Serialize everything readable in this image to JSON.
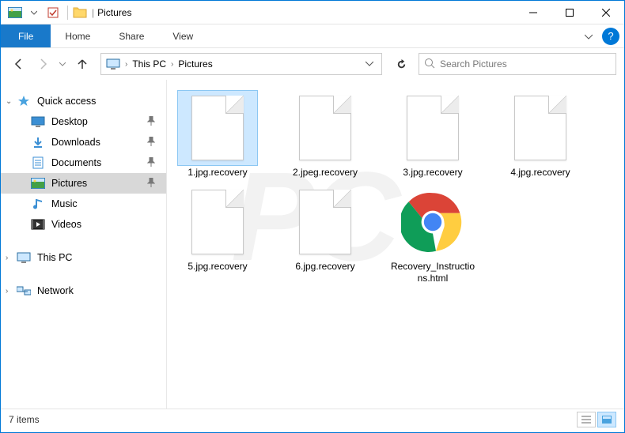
{
  "window": {
    "title": "Pictures"
  },
  "ribbon": {
    "file": "File",
    "tabs": [
      "Home",
      "Share",
      "View"
    ]
  },
  "breadcrumb": {
    "root_chev": "›",
    "items": [
      "This PC",
      "Pictures"
    ]
  },
  "search": {
    "placeholder": "Search Pictures"
  },
  "nav_pane": {
    "quick_access": {
      "label": "Quick access",
      "items": [
        {
          "label": "Desktop",
          "pinned": true
        },
        {
          "label": "Downloads",
          "pinned": true
        },
        {
          "label": "Documents",
          "pinned": true
        },
        {
          "label": "Pictures",
          "pinned": true,
          "selected": true
        },
        {
          "label": "Music",
          "pinned": false
        },
        {
          "label": "Videos",
          "pinned": false
        }
      ]
    },
    "this_pc": {
      "label": "This PC"
    },
    "network": {
      "label": "Network"
    }
  },
  "files": [
    {
      "name": "1.jpg.recovery",
      "icon": "blank",
      "selected": true
    },
    {
      "name": "2.jpeg.recovery",
      "icon": "blank"
    },
    {
      "name": "3.jpg.recovery",
      "icon": "blank"
    },
    {
      "name": "4.jpg.recovery",
      "icon": "blank"
    },
    {
      "name": "5.jpg.recovery",
      "icon": "blank"
    },
    {
      "name": "6.jpg.recovery",
      "icon": "blank"
    },
    {
      "name": "Recovery_Instructions.html",
      "icon": "chrome"
    }
  ],
  "status": {
    "count_label": "7 items"
  }
}
